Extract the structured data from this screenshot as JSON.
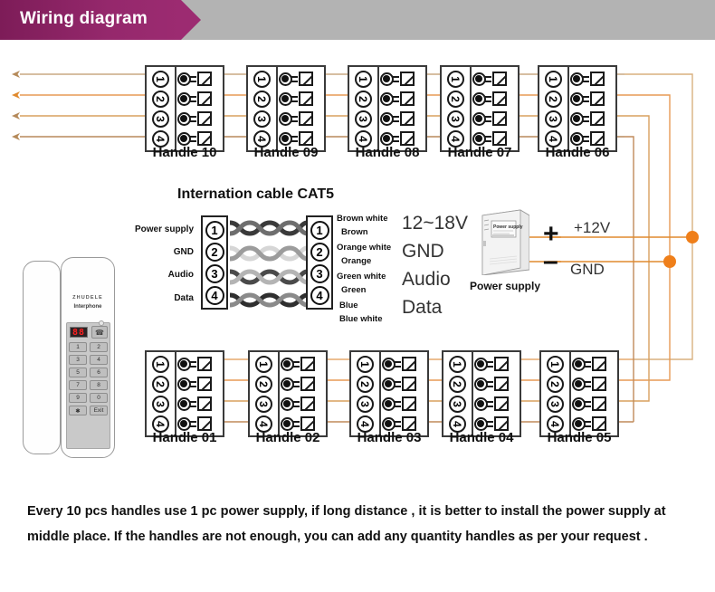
{
  "header": {
    "title": "Wiring diagram",
    "banner_color": "#9c2b71",
    "bar_color": "#b3b3b3"
  },
  "diagram": {
    "wire_color_primary": "#e08a2e",
    "wire_color_secondary": "#c08a5a",
    "junction_color": "#ef7f1a",
    "top_handles": [
      {
        "name": "Handle 10"
      },
      {
        "name": "Handle 09"
      },
      {
        "name": "Handle 08"
      },
      {
        "name": "Handle 07"
      },
      {
        "name": "Handle 06"
      }
    ],
    "bottom_handles": [
      {
        "name": "Handle 01"
      },
      {
        "name": "Handle 02"
      },
      {
        "name": "Handle 03"
      },
      {
        "name": "Handle 04"
      },
      {
        "name": "Handle 05"
      }
    ],
    "terminal_pins": [
      "1",
      "2",
      "3",
      "4"
    ]
  },
  "cat5": {
    "title": "Internation cable CAT5",
    "left_labels": [
      "Power supply",
      "GND",
      "Audio",
      "Data"
    ],
    "left_pins": [
      "1",
      "2",
      "3",
      "4"
    ],
    "right_pins": [
      "1",
      "2",
      "3",
      "4"
    ],
    "right_labels": [
      {
        "top": "Brown white",
        "bottom": "Brown"
      },
      {
        "top": "Orange white",
        "bottom": "Orange"
      },
      {
        "top": "Green white",
        "bottom": "Green"
      },
      {
        "top": "Blue",
        "bottom": "Blue white"
      }
    ],
    "signals": [
      "12~18V",
      "GND",
      "Audio",
      "Data"
    ]
  },
  "power_supply": {
    "caption": "Power supply",
    "box_label": "Power supply",
    "plus_sign": "+",
    "minus_sign": "–",
    "plus_wire_label": "+12V",
    "minus_wire_label": "GND"
  },
  "handset": {
    "brand": "ZHUDELE",
    "sub_brand": "Interphone",
    "display_value": "88",
    "key_icon": "☎",
    "keys": [
      "1",
      "2",
      "3",
      "4",
      "5",
      "6",
      "7",
      "8",
      "9",
      "0",
      "✱",
      "Exit"
    ]
  },
  "footer": {
    "text": "Every 10 pcs handles use 1 pc power supply, if  long distance , it is better to install the power supply at middle place. If the handles are not enough, you can add any quantity handles as per your request ."
  }
}
